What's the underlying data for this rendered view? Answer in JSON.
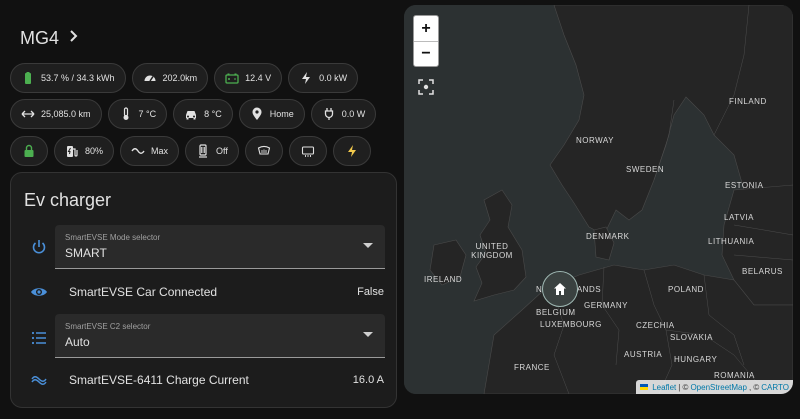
{
  "header": {
    "title": "MG4"
  },
  "chips_row1": [
    {
      "icon": "battery-icon",
      "text": "53.7 % / 34.3 kWh"
    },
    {
      "icon": "gauge-icon",
      "text": "202.0km"
    },
    {
      "icon": "car-battery-icon",
      "text": "12.4 V"
    },
    {
      "icon": "lightning-icon",
      "text": "0.0 kW"
    }
  ],
  "chips_row2": [
    {
      "icon": "range-arrows-icon",
      "text": "25,085.0 km"
    },
    {
      "icon": "thermometer-icon",
      "text": "7 °C"
    },
    {
      "icon": "car-icon",
      "text": "8 °C"
    },
    {
      "icon": "map-pin-icon",
      "text": "Home"
    },
    {
      "icon": "plug-icon",
      "text": "0.0 W"
    }
  ],
  "chips_row3": [
    {
      "icon": "lock-icon",
      "text": ""
    },
    {
      "icon": "fuel-charge-icon",
      "text": "80%"
    },
    {
      "icon": "wave-icon",
      "text": "Max"
    },
    {
      "icon": "seat-heater-icon",
      "text": "Off"
    },
    {
      "icon": "front-defrost-icon",
      "text": ""
    },
    {
      "icon": "rear-defrost-icon",
      "text": ""
    },
    {
      "icon": "bolt-icon",
      "text": ""
    }
  ],
  "colors": {
    "green": "#4caf50",
    "yellow": "#f2c94c",
    "blue": "#4a8fd8"
  },
  "charger": {
    "title": "Ev charger",
    "mode_selector": {
      "label": "SmartEVSE Mode selector",
      "value": "SMART"
    },
    "car_connected": {
      "name": "SmartEVSE Car Connected",
      "state": "False"
    },
    "c2_selector": {
      "label": "SmartEVSE C2 selector",
      "value": "Auto"
    },
    "charge_current": {
      "name": "SmartEVSE-6411 Charge Current",
      "state": "16.0 A"
    }
  },
  "map": {
    "zoom_in": "+",
    "zoom_out": "−",
    "labels": [
      "NORWAY",
      "SWEDEN",
      "FINLAND",
      "ESTONIA",
      "LATVIA",
      "LITHUANIA",
      "DENMARK",
      "UNITED KINGDOM",
      "IRELAND",
      "BELARUS",
      "POLAND",
      "GERMANY",
      "NETHERLANDS",
      "BELGIUM",
      "LUXEMBOURG",
      "CZECHIA",
      "SLOVAKIA",
      "AUSTRIA",
      "HUNGARY",
      "FRANCE",
      "ROMANIA"
    ],
    "attribution": {
      "leaflet": "Leaflet",
      "sep1": "| ©",
      "osm": "OpenStreetMap",
      "sep2": ", ©",
      "carto": "CARTO"
    }
  }
}
